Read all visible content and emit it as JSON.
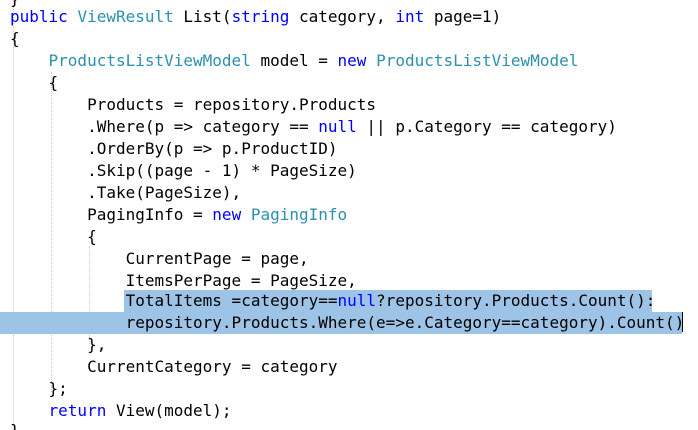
{
  "editor": {
    "colors": {
      "background": "#ffffff",
      "keyword": "#0000ff",
      "type": "#2b91af",
      "text": "#000000",
      "selection": "#9dc3e6"
    },
    "lines": [
      {
        "tokens": [
          {
            "c": "pl",
            "t": "}"
          }
        ]
      },
      {
        "tokens": [
          {
            "c": "kw",
            "t": "public "
          },
          {
            "c": "ty",
            "t": "ViewResult"
          },
          {
            "c": "pl",
            "t": " List("
          },
          {
            "c": "kw",
            "t": "string"
          },
          {
            "c": "pl",
            "t": " category, "
          },
          {
            "c": "kw",
            "t": "int"
          },
          {
            "c": "pl",
            "t": " page=1)"
          }
        ]
      },
      {
        "tokens": [
          {
            "c": "pl",
            "t": "{"
          }
        ]
      },
      {
        "tokens": [
          {
            "c": "pl",
            "t": "    "
          },
          {
            "c": "ty",
            "t": "ProductsListViewModel"
          },
          {
            "c": "pl",
            "t": " model = "
          },
          {
            "c": "kw",
            "t": "new "
          },
          {
            "c": "ty",
            "t": "ProductsListViewModel"
          }
        ]
      },
      {
        "tokens": [
          {
            "c": "pl",
            "t": "    {"
          }
        ]
      },
      {
        "tokens": [
          {
            "c": "pl",
            "t": "        Products = repository.Products"
          }
        ]
      },
      {
        "tokens": [
          {
            "c": "pl",
            "t": "        .Where(p => category == "
          },
          {
            "c": "kw",
            "t": "null"
          },
          {
            "c": "pl",
            "t": " || p.Category == category)"
          }
        ]
      },
      {
        "tokens": [
          {
            "c": "pl",
            "t": "        .OrderBy(p => p.ProductID)"
          }
        ]
      },
      {
        "tokens": [
          {
            "c": "pl",
            "t": "        .Skip((page - 1) * PageSize)"
          }
        ]
      },
      {
        "tokens": [
          {
            "c": "pl",
            "t": "        .Take(PageSize),"
          }
        ]
      },
      {
        "tokens": [
          {
            "c": "pl",
            "t": "        PagingInfo = "
          },
          {
            "c": "kw",
            "t": "new "
          },
          {
            "c": "ty",
            "t": "PagingInfo"
          }
        ]
      },
      {
        "tokens": [
          {
            "c": "pl",
            "t": "        {"
          }
        ]
      },
      {
        "tokens": [
          {
            "c": "pl",
            "t": "            CurrentPage = page,"
          }
        ]
      },
      {
        "tokens": [
          {
            "c": "pl",
            "t": "            ItemsPerPage = PageSize,"
          }
        ]
      },
      {
        "tokens": [
          {
            "c": "pl",
            "t": "            TotalItems =category=="
          },
          {
            "c": "kw",
            "t": "null"
          },
          {
            "c": "pl",
            "t": "?repository.Products.Count():"
          }
        ]
      },
      {
        "tokens": [
          {
            "c": "pl",
            "t": "            repository.Products.Where(e=>e.Category==category).Count()"
          }
        ]
      },
      {
        "tokens": [
          {
            "c": "pl",
            "t": "        },"
          }
        ]
      },
      {
        "tokens": [
          {
            "c": "pl",
            "t": "        CurrentCategory = category"
          }
        ]
      },
      {
        "tokens": [
          {
            "c": "pl",
            "t": "    };"
          }
        ]
      },
      {
        "tokens": [
          {
            "c": "pl",
            "t": "    "
          },
          {
            "c": "kw",
            "t": "return"
          },
          {
            "c": "pl",
            "t": " View(model);"
          }
        ]
      },
      {
        "tokens": [
          {
            "c": "pl",
            "t": "}"
          }
        ]
      }
    ]
  }
}
